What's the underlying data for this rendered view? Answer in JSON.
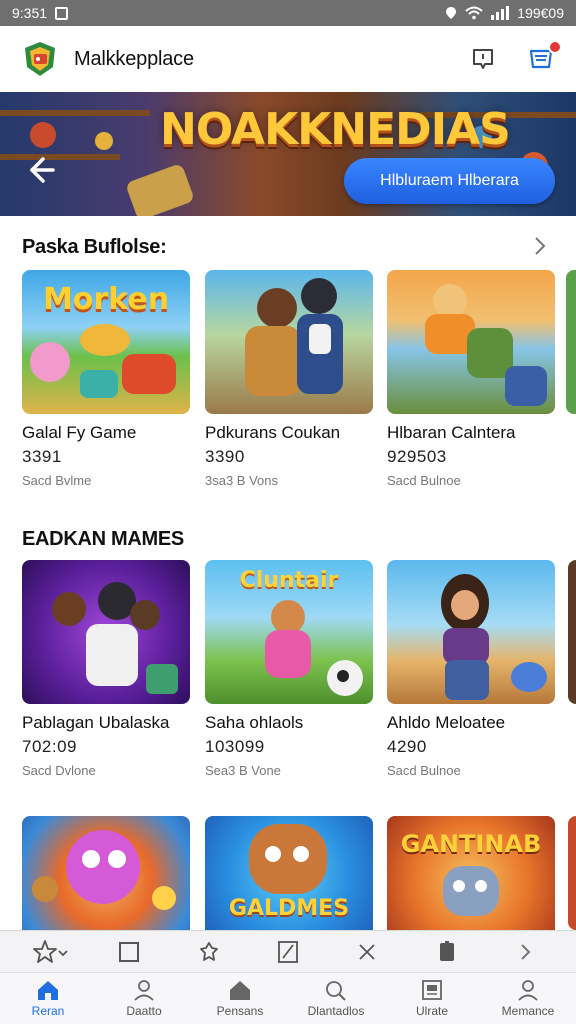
{
  "status_bar": {
    "time": "9:351",
    "battery_text": "199€09"
  },
  "header": {
    "title": "Malkkepplace"
  },
  "banner": {
    "title": "NOAKKNEDIAS",
    "cta_label": "Hlbluraem Hlberara"
  },
  "sections": [
    {
      "title": "Paska Buflolse:",
      "cards": [
        {
          "art_word": "Morken",
          "name": "Galal Fy Game",
          "meta": "3391",
          "sub": "Sacd Bvlme"
        },
        {
          "art_word": "",
          "name": "Pdkurans Coukan",
          "meta": "3390",
          "sub": "3sa3 B Vons"
        },
        {
          "art_word": "",
          "name": "Hlbaran Calntera",
          "meta": "929503",
          "sub": "Sacd Bulnoe"
        }
      ]
    },
    {
      "title": "EADKAN MAMES",
      "cards": [
        {
          "art_word": "",
          "name": "Pablagan Ubalaska",
          "meta": "702:09",
          "sub": "Sacd Dvlone"
        },
        {
          "art_word": "Cluntair",
          "name": "Saha ohlaols",
          "meta": "103099",
          "sub": "Sea3 B Vone"
        },
        {
          "art_word": "",
          "name": "Ahldo Meloatee",
          "meta": "4290",
          "sub": "Sacd Bulnoe"
        }
      ]
    },
    {
      "title": "",
      "cards": [
        {
          "art_word": "",
          "name": "",
          "meta": "",
          "sub": ""
        },
        {
          "art_word": "GALDMES",
          "name": "",
          "meta": "",
          "sub": ""
        },
        {
          "art_word": "GANTINAB",
          "name": "",
          "meta": "",
          "sub": ""
        }
      ]
    }
  ],
  "bottom_nav": [
    {
      "label": "Reran",
      "icon": "home-icon",
      "active": true
    },
    {
      "label": "Daatto",
      "icon": "profile-icon",
      "active": false
    },
    {
      "label": "Pensans",
      "icon": "house-icon",
      "active": false
    },
    {
      "label": "Dlantadlos",
      "icon": "search-icon",
      "active": false
    },
    {
      "label": "Ulrate",
      "icon": "grid-icon",
      "active": false
    },
    {
      "label": "Memance",
      "icon": "account-icon",
      "active": false
    }
  ],
  "colors": {
    "accent": "#1f6fe0",
    "cta": "#2f75f5",
    "badge": "#e53935"
  }
}
